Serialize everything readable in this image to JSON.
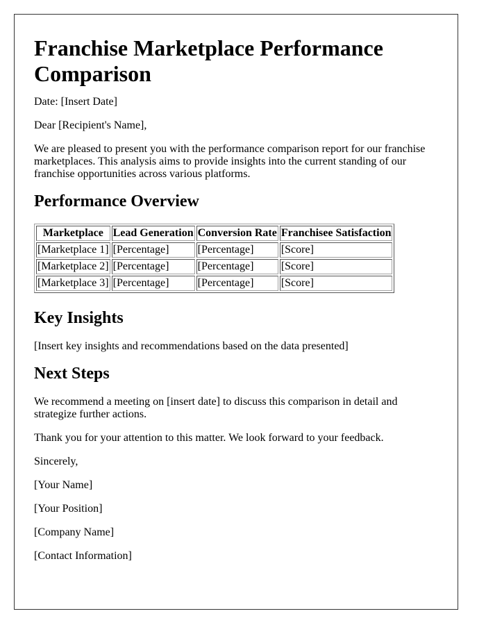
{
  "document": {
    "title": "Franchise Marketplace Performance Comparison",
    "date_line": "Date: [Insert Date]",
    "greeting": "Dear [Recipient's Name],",
    "intro": "We are pleased to present you with the performance comparison report for our franchise marketplaces. This analysis aims to provide insights into the current standing of our franchise opportunities across various platforms."
  },
  "overview": {
    "heading": "Performance Overview",
    "table": {
      "headers": [
        "Marketplace",
        "Lead Generation",
        "Conversion Rate",
        "Franchisee Satisfaction"
      ],
      "rows": [
        [
          "[Marketplace 1]",
          "[Percentage]",
          "[Percentage]",
          "[Score]"
        ],
        [
          "[Marketplace 2]",
          "[Percentage]",
          "[Percentage]",
          "[Score]"
        ],
        [
          "[Marketplace 3]",
          "[Percentage]",
          "[Percentage]",
          "[Score]"
        ]
      ]
    }
  },
  "insights": {
    "heading": "Key Insights",
    "text": "[Insert key insights and recommendations based on the data presented]"
  },
  "next_steps": {
    "heading": "Next Steps",
    "paragraph1": "We recommend a meeting on [insert date] to discuss this comparison in detail and strategize further actions.",
    "paragraph2": "Thank you for your attention to this matter. We look forward to your feedback."
  },
  "closing": {
    "valediction": "Sincerely,",
    "name": "[Your Name]",
    "position": "[Your Position]",
    "company": "[Company Name]",
    "contact": "[Contact Information]"
  }
}
